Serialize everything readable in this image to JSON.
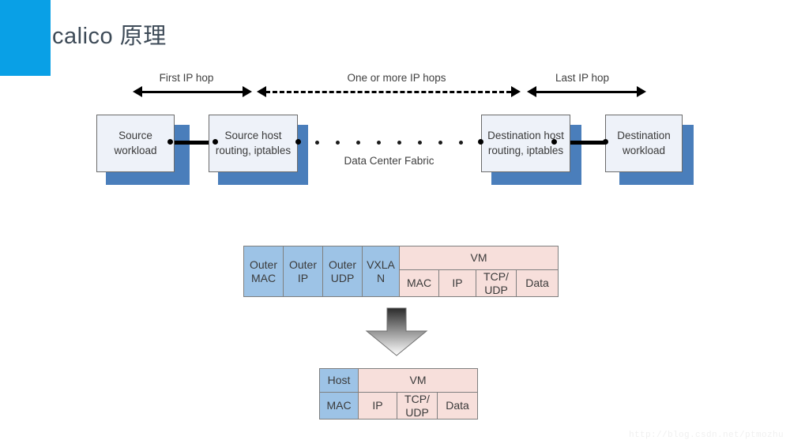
{
  "slide": {
    "title": "calico 原理",
    "accent_color": "#09a0e6",
    "watermark": "http://blog.csdn.net/ptmozhu"
  },
  "network_diagram": {
    "hop_labels": [
      {
        "text": "First IP hop"
      },
      {
        "text": "One or more IP hops"
      },
      {
        "text": "Last IP hop"
      }
    ],
    "nodes": [
      {
        "line1": "Source",
        "line2": "workload"
      },
      {
        "line1": "Source host",
        "line2": "routing, iptables"
      },
      {
        "line1": "Destination host",
        "line2": "routing, iptables"
      },
      {
        "line1": "Destination",
        "line2": "workload"
      }
    ],
    "fabric_label": "Data Center Fabric",
    "box_fill": "#eef2f9",
    "box_shadow_color": "#4a7ebb"
  },
  "encap_table": {
    "outer_cells": [
      {
        "line1": "Outer",
        "line2": "MAC"
      },
      {
        "line1": "Outer",
        "line2": "IP"
      },
      {
        "line1": "Outer",
        "line2": "UDP"
      },
      {
        "line1": "VXLA",
        "line2": "N"
      }
    ],
    "inner_header": "VM",
    "inner_cells": [
      {
        "line1": "MAC",
        "line2": ""
      },
      {
        "line1": "IP",
        "line2": ""
      },
      {
        "line1": "TCP/",
        "line2": "UDP"
      },
      {
        "line1": "Data",
        "line2": ""
      }
    ],
    "blue_color": "#9dc3e6",
    "pink_color": "#f7dfdb"
  },
  "plain_table": {
    "host_header": "Host",
    "host_value": "MAC",
    "vm_header": "VM",
    "vm_cells": [
      {
        "line1": "IP",
        "line2": ""
      },
      {
        "line1": "TCP/",
        "line2": "UDP"
      },
      {
        "line1": "Data",
        "line2": ""
      }
    ]
  }
}
